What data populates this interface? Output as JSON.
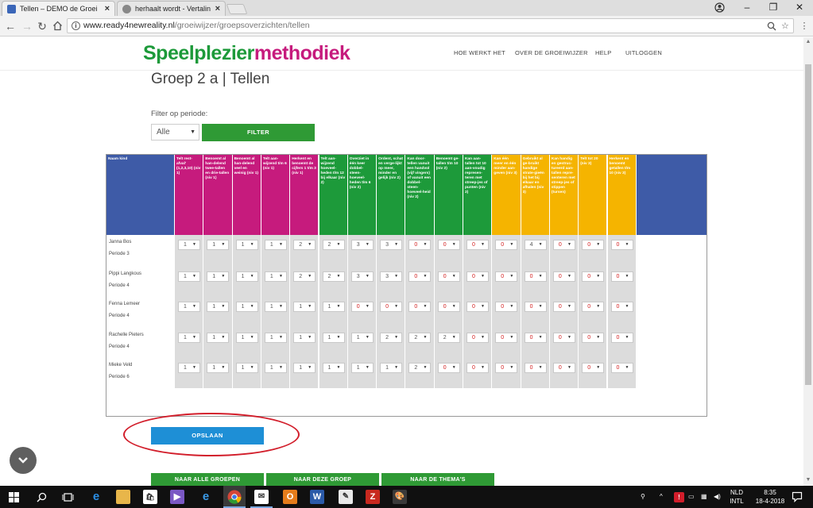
{
  "browser": {
    "tabs": [
      {
        "title": "Tellen – DEMO de Groei",
        "close": "×"
      },
      {
        "title": "herhaalt wordt - Vertalin",
        "close": "×"
      }
    ],
    "window_controls": {
      "minimize": "–",
      "restore": "❐",
      "close": "✕"
    },
    "nav": {
      "back": "←",
      "forward": "→",
      "reload": "↻"
    },
    "address": {
      "host": "www.ready4newreality.nl",
      "path": "/groeiwijzer/groepsoverzichten/tellen"
    }
  },
  "site": {
    "logo": {
      "part1": "Speelplezier",
      "part2": "methodiek"
    },
    "nav": [
      "HOE WERKT HET",
      "OVER DE GROEIWIJZER",
      "HELP",
      "UITLOGGEN"
    ]
  },
  "page": {
    "title": "Groep 2 a | Tellen",
    "filter_label": "Filter op periode:",
    "period_value": "Alle",
    "filter_button": "FILTER",
    "save_button": "OPSLAAN",
    "bottom_buttons": [
      "NAAR ALLE GROEPEN",
      "NAAR DEZE GROEP",
      "NAAR DE THEMA'S"
    ]
  },
  "grid": {
    "name_header": "Naam kind",
    "columns": [
      {
        "label": "Telt rest-afval' (1,2,3,10) (niv 1)",
        "color": "#c61b7d"
      },
      {
        "label": "Benoemt al han-delend twee-tallen en drie-tallen (niv 1)",
        "color": "#c61b7d"
      },
      {
        "label": "Benoemt al han-delend veel en weinig (niv 1)",
        "color": "#c61b7d"
      },
      {
        "label": "Telt aan-wijzend t/m 6 (niv 1)",
        "color": "#c61b7d"
      },
      {
        "label": "Herkent en benoemt de cijfers 1 t/m 3 (niv 1)",
        "color": "#c61b7d"
      },
      {
        "label": "Telt aan-wijzend hoeveel-heden t/m 12 bij elkaar (niv 2)",
        "color": "#1d9a3a"
      },
      {
        "label": "Overziet in één keer dobbel-steen-hoeveel-heden t/m 6 (niv 2)",
        "color": "#1d9a3a"
      },
      {
        "label": "Ordent, schat en verge-lijkt op meer, minder en gelijk (niv 2)",
        "color": "#1d9a3a"
      },
      {
        "label": "Kan door-tellen vanuit een handvol (vijf vingers) of vanuit een dobbel-steen-hoeveel-heid (niv 2)",
        "color": "#1d9a3a"
      },
      {
        "label": "Benoemt ge-tallen t/m 10 (niv 2)",
        "color": "#1d9a3a"
      },
      {
        "label": "Kan aan-tallen tot 10 aan-voudig represen-teren met streep-jes of punten (niv 2)",
        "color": "#1d9a3a"
      },
      {
        "label": "Kan één meer en één minder aan-geven (niv 3)",
        "color": "#f5b400"
      },
      {
        "label": "Gebruikt al ge-bruikt handige strate-gieën bij het bij elkaar en afhalen (niv 3)",
        "color": "#f5b400"
      },
      {
        "label": "Kan handig en gestruc-tureerd aan-tallen repre-senteren met streep-jes of stippen (tursen)",
        "color": "#f5b400"
      },
      {
        "label": "Telt tot 20 (niv 3)",
        "color": "#f5b400"
      },
      {
        "label": "Herkent en benoemt getallen t/m 10 (niv 3)",
        "color": "#f5b400"
      }
    ],
    "rows": [
      {
        "name": "Janna Bos",
        "period": "Periode 3",
        "values": [
          "1",
          "1",
          "1",
          "1",
          "2",
          "2",
          "3",
          "3",
          "0",
          "0",
          "0",
          "0",
          "4",
          "0",
          "0",
          "0"
        ]
      },
      {
        "name": "Pippi Langkous",
        "period": "Periode 4",
        "values": [
          "1",
          "1",
          "1",
          "1",
          "2",
          "2",
          "3",
          "3",
          "0",
          "0",
          "0",
          "0",
          "0",
          "0",
          "0",
          "0"
        ]
      },
      {
        "name": "Fenna Lemeer",
        "period": "Periode 4",
        "values": [
          "1",
          "1",
          "1",
          "1",
          "1",
          "1",
          "0",
          "0",
          "0",
          "0",
          "0",
          "0",
          "0",
          "0",
          "0",
          "0"
        ]
      },
      {
        "name": "Rachelle Pieters",
        "period": "Periode 4",
        "values": [
          "1",
          "1",
          "1",
          "1",
          "1",
          "1",
          "1",
          "2",
          "2",
          "2",
          "0",
          "0",
          "0",
          "0",
          "0",
          "0"
        ]
      },
      {
        "name": "Mieke Veld",
        "period": "Periode 6",
        "values": [
          "1",
          "1",
          "1",
          "1",
          "1",
          "1",
          "1",
          "1",
          "2",
          "0",
          "0",
          "0",
          "0",
          "0",
          "0",
          "0"
        ]
      }
    ],
    "zero_color": "#d42020"
  },
  "taskbar": {
    "lang_top": "NLD",
    "lang_bottom": "INTL",
    "time": "8:35",
    "date": "18-4-2018"
  }
}
